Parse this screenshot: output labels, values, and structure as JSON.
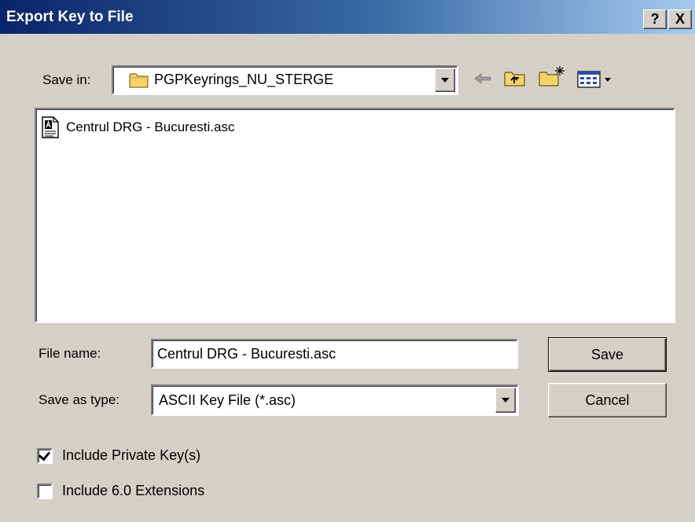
{
  "window": {
    "title": "Export Key to File",
    "help_label": "?",
    "close_label": "X"
  },
  "save_in": {
    "label": "Save in:",
    "value": "PGPKeyrings_NU_STERGE"
  },
  "toolbar": {
    "icons": [
      "back-arrow-icon",
      "up-folder-icon",
      "new-folder-icon",
      "view-menu-icon"
    ]
  },
  "file_list": {
    "items": [
      {
        "name": "Centrul DRG - Bucuresti.asc",
        "icon": "ascii-file-icon"
      }
    ]
  },
  "file_name": {
    "label": "File name:",
    "value": "Centrul DRG - Bucuresti.asc"
  },
  "save_as_type": {
    "label": "Save as type:",
    "value": "ASCII Key File (*.asc)"
  },
  "buttons": {
    "save": "Save",
    "cancel": "Cancel"
  },
  "options": {
    "include_private": {
      "label": "Include Private Key(s)",
      "checked": true
    },
    "include_extensions": {
      "label": "Include 6.0 Extensions",
      "checked": false
    }
  }
}
